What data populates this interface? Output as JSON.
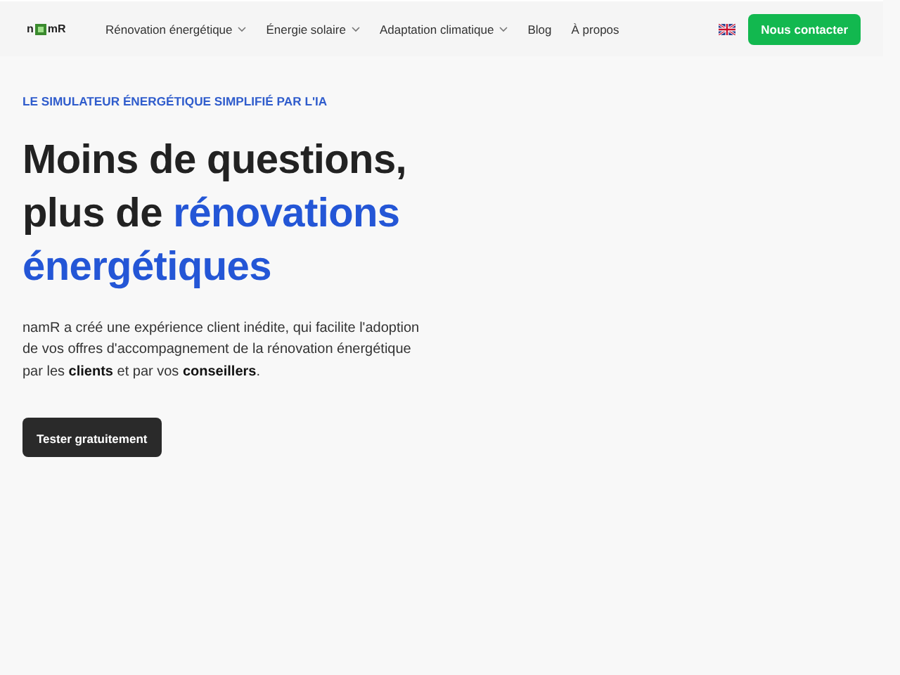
{
  "nav": {
    "logo": {
      "before": "n",
      "after": "mR"
    },
    "items": [
      {
        "label": "Rénovation énergétique",
        "dropdown": true
      },
      {
        "label": "Énergie solaire",
        "dropdown": true
      },
      {
        "label": "Adaptation climatique",
        "dropdown": true
      },
      {
        "label": "Blog",
        "dropdown": false
      },
      {
        "label": "À propos",
        "dropdown": false
      }
    ],
    "contact_button": "Nous contacter"
  },
  "hero": {
    "eyebrow": "LE SIMULATEUR ÉNERGÉTIQUE SIMPLIFIÉ PAR L'IA",
    "heading": [
      {
        "text": "Moins de questions, plus de ",
        "accent": false
      },
      {
        "text": "rénovations énergétiques",
        "accent": true
      }
    ],
    "description": "namR a créé une expérience client inédite, qui facilite l'adoption de vos offres d'accompagnement de la rénovation énergétique par les **clients** et par vos **conseillers**.",
    "cta_button": "Tester gratuitement"
  }
}
